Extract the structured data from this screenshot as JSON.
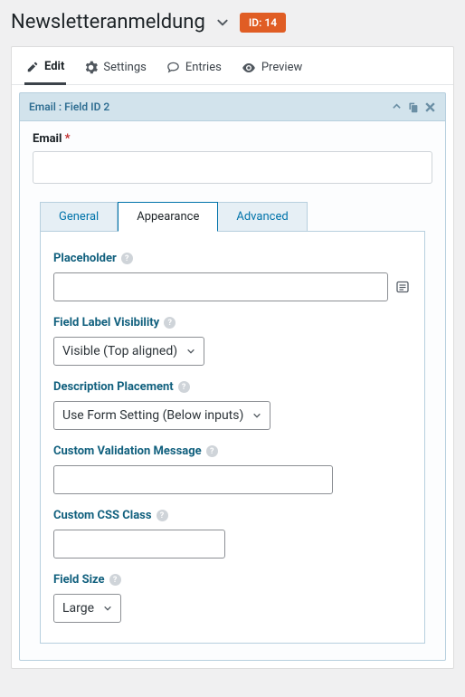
{
  "header": {
    "title": "Newsletteranmeldung",
    "id_prefix": "ID:",
    "id_value": "14"
  },
  "main_tabs": {
    "edit": "Edit",
    "settings": "Settings",
    "entries": "Entries",
    "preview": "Preview"
  },
  "field_header": "Email : Field ID 2",
  "field_label": "Email",
  "sub_tabs": {
    "general": "General",
    "appearance": "Appearance",
    "advanced": "Advanced"
  },
  "settings": {
    "placeholder_label": "Placeholder",
    "placeholder_value": "",
    "label_visibility_label": "Field Label Visibility",
    "label_visibility_value": "Visible (Top aligned)",
    "desc_placement_label": "Description Placement",
    "desc_placement_value": "Use Form Setting (Below inputs)",
    "validation_msg_label": "Custom Validation Message",
    "validation_msg_value": "",
    "css_class_label": "Custom CSS Class",
    "css_class_value": "",
    "field_size_label": "Field Size",
    "field_size_value": "Large"
  }
}
